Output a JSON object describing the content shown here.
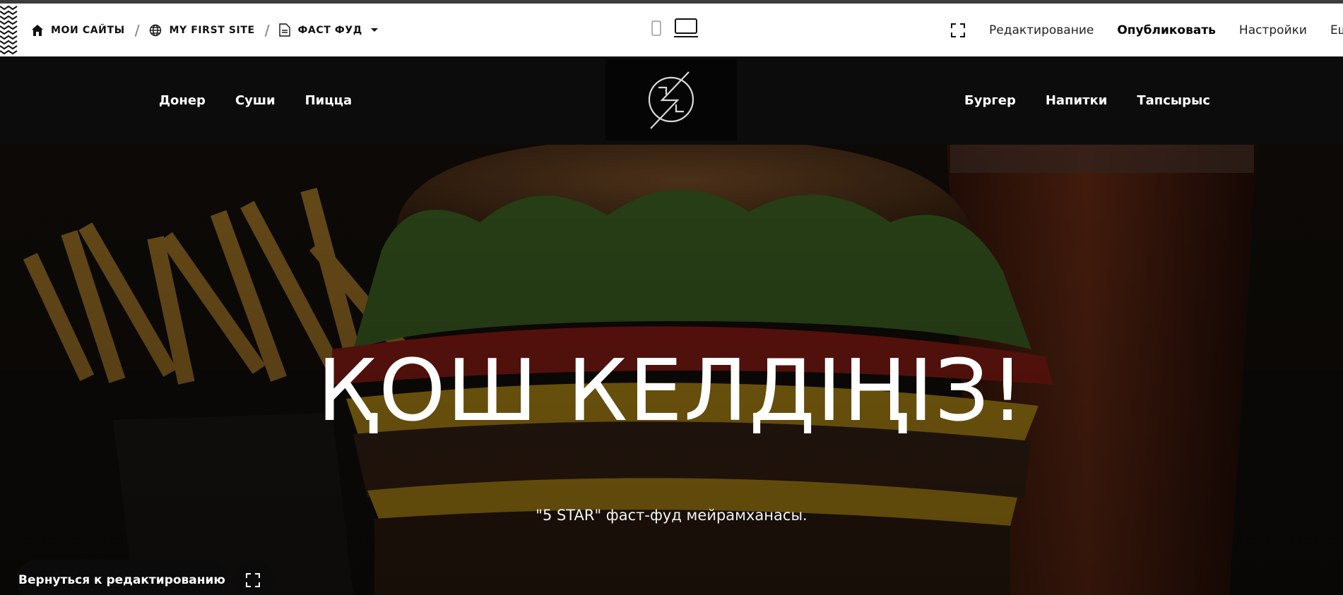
{
  "editor_bar": {
    "breadcrumbs": [
      {
        "label": "МОИ САЙТЫ",
        "icon": "home-icon"
      },
      {
        "label": "MY FIRST SITE",
        "icon": "globe-icon"
      },
      {
        "label": "ФАСТ ФУД",
        "icon": "page-icon"
      }
    ],
    "separator": "/",
    "device_modes": [
      "mobile-icon",
      "desktop-icon"
    ],
    "actions": {
      "fullscreen_icon": "fullscreen-icon",
      "edit": "Редактирование",
      "publish": "Опубликовать",
      "settings": "Настройки",
      "more": "Еще"
    }
  },
  "site": {
    "nav_left": [
      "Донер",
      "Суши",
      "Пицца"
    ],
    "nav_right": [
      "Бургер",
      "Напитки",
      "Тапсырыс"
    ],
    "hero": {
      "title": "ҚОШ КЕЛДІҢІЗ!",
      "subtitle": "\"5 STAR\" фаст-фуд мейрамханасы."
    }
  },
  "floating": {
    "back_label": "Вернуться к редактированию",
    "fullscreen_icon": "fullscreen-icon"
  },
  "colors": {
    "editor_bg": "#ffffff",
    "header_bg": "#0c0c0c",
    "text_dark": "#111111",
    "text_light": "#ffffff"
  }
}
